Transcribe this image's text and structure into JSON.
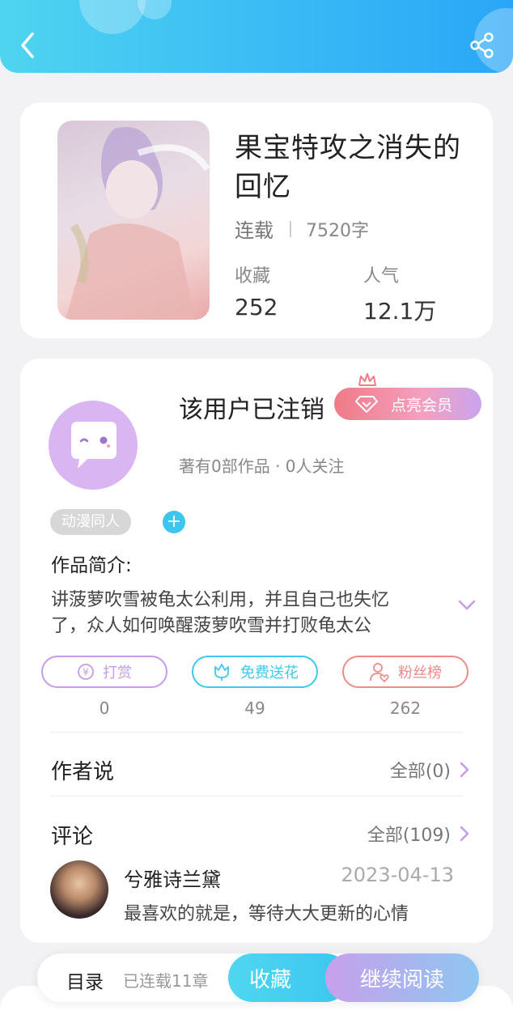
{
  "header": {
    "back_icon": "chevron-left-icon",
    "share_icon": "share-icon"
  },
  "book": {
    "title": "果宝特攻之消失的回忆",
    "status": "连载",
    "word_count": "7520字",
    "favorites_label": "收藏",
    "favorites_value": "252",
    "popularity_label": "人气",
    "popularity_value": "12.1万"
  },
  "author": {
    "name": "该用户已注销",
    "vip_label": "点亮会员",
    "stats": "著有0部作品 · 0人关注"
  },
  "tag": "动漫同人",
  "intro": {
    "label": "作品简介:",
    "text": "讲菠萝吹雪被龟太公利用，并且自己也失忆了，众人如何唤醒菠萝吹雪并打败龟太公"
  },
  "actions": [
    {
      "label": "打赏",
      "count": "0",
      "color": "#c79be8"
    },
    {
      "label": "免费送花",
      "count": "49",
      "color": "#3fc8ec"
    },
    {
      "label": "粉丝榜",
      "count": "262",
      "color": "#ef8a8a"
    }
  ],
  "author_says": {
    "title": "作者说",
    "more": "全部(0)"
  },
  "comments": {
    "title": "评论",
    "more": "全部(109)",
    "items": [
      {
        "user": "兮雅诗兰黛",
        "date": "2023-04-13",
        "text": "最喜欢的就是，等待大大更新的心情"
      }
    ]
  },
  "bottom_bar": {
    "toc_label": "目录",
    "chapters": "已连载11章",
    "favorite_button": "收藏",
    "read_button": "继续阅读"
  }
}
